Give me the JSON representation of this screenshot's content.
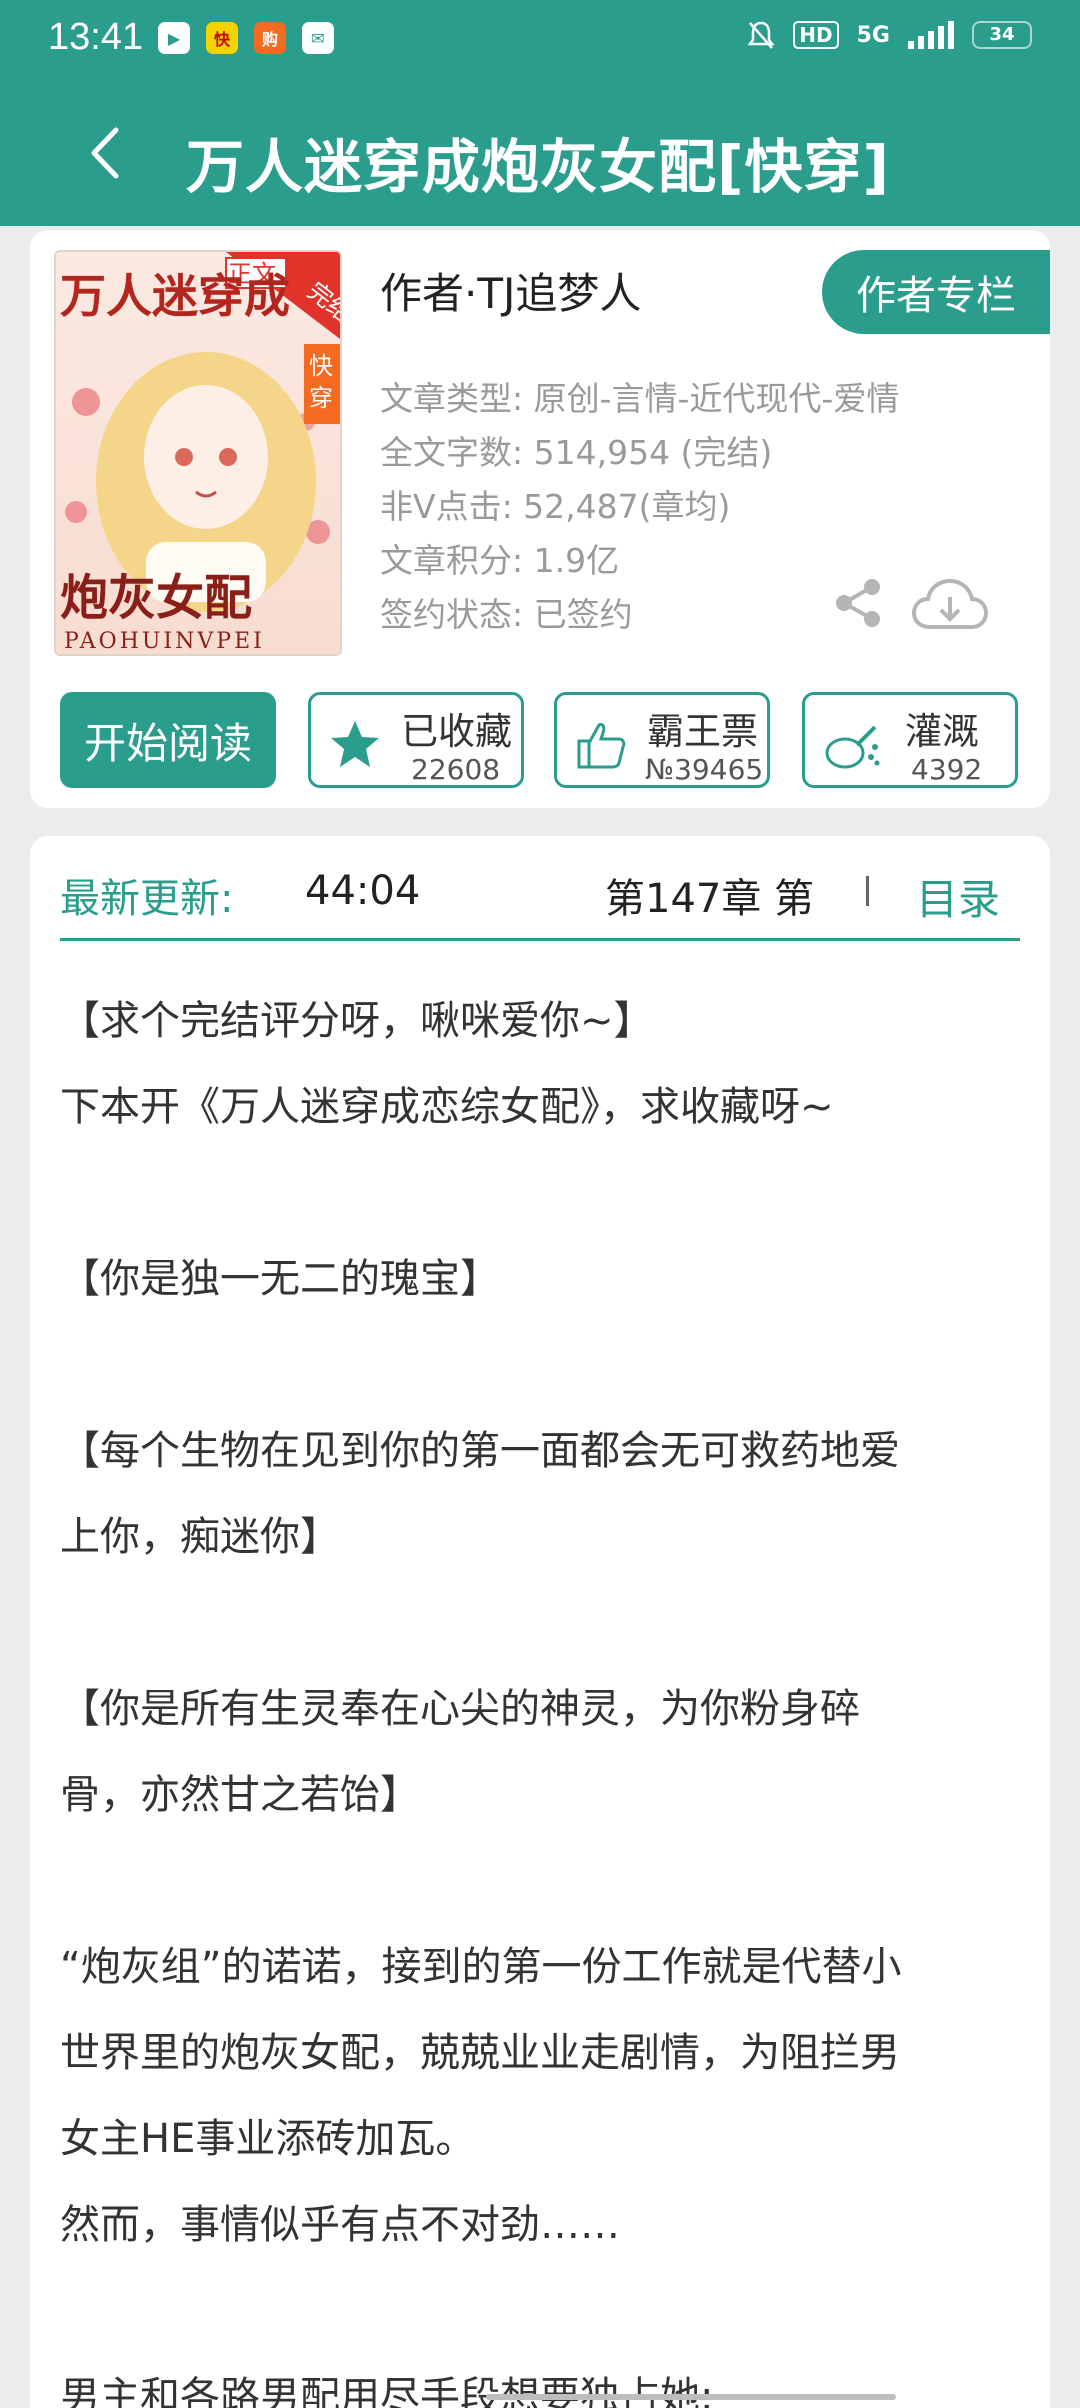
{
  "status_bar": {
    "time": "13:41",
    "network": "5G",
    "hd": "HD",
    "battery": "34",
    "apps": [
      "app-icon-video",
      "app-icon-kuaikan",
      "app-icon-shop",
      "app-icon-message"
    ]
  },
  "header": {
    "title": "万人迷穿成炮灰女配[快穿]"
  },
  "book": {
    "cover": {
      "title_top": "万人迷穿成",
      "title_bottom": "炮灰女配",
      "pinyin": "PAOHUINVPEI",
      "tag_main": "正文",
      "tag_corner": "完结",
      "tag_side": "快穿"
    },
    "author": "作者·TJ追梦人",
    "author_column": "作者专栏",
    "meta": [
      "文章类型: 原创-言情-近代现代-爱情",
      "全文字数: 514,954 (完结)",
      "非V点击: 52,487(章均)",
      "文章积分: 1.9亿",
      "签约状态:  已签约"
    ]
  },
  "actions": {
    "read": "开始阅读",
    "collect": {
      "label": "已收藏",
      "count": "22608"
    },
    "ticket": {
      "label": "霸王票",
      "count": "№39465"
    },
    "water": {
      "label": "灌溉",
      "count": "4392"
    }
  },
  "latest": {
    "label": "最新更新:",
    "time": "44:04",
    "chapter": "第147章  第",
    "toc": "目录"
  },
  "intro": [
    "【求个完结评分呀，啾咪爱你~】",
    "下本开《万人迷穿成恋综女配》，求收藏呀~",
    "",
    "【你是独一无二的瑰宝】",
    "",
    "【每个生物在见到你的第一面都会无可救药地爱",
    "上你，痴迷你】",
    "",
    "【你是所有生灵奉在心尖的神灵，为你粉身碎",
    "骨，亦然甘之若饴】",
    "",
    "“炮灰组”的诺诺，接到的第一份工作就是代替小",
    "世界里的炮灰女配，兢兢业业走剧情，为阻拦男",
    "女主HE事业添砖加瓦。",
    "然而，事情似乎有点不对劲……",
    "",
    "男主和各路男配用尽手段想要独占她;"
  ],
  "colors": {
    "accent": "#2a9d8c",
    "background": "#ececec"
  }
}
